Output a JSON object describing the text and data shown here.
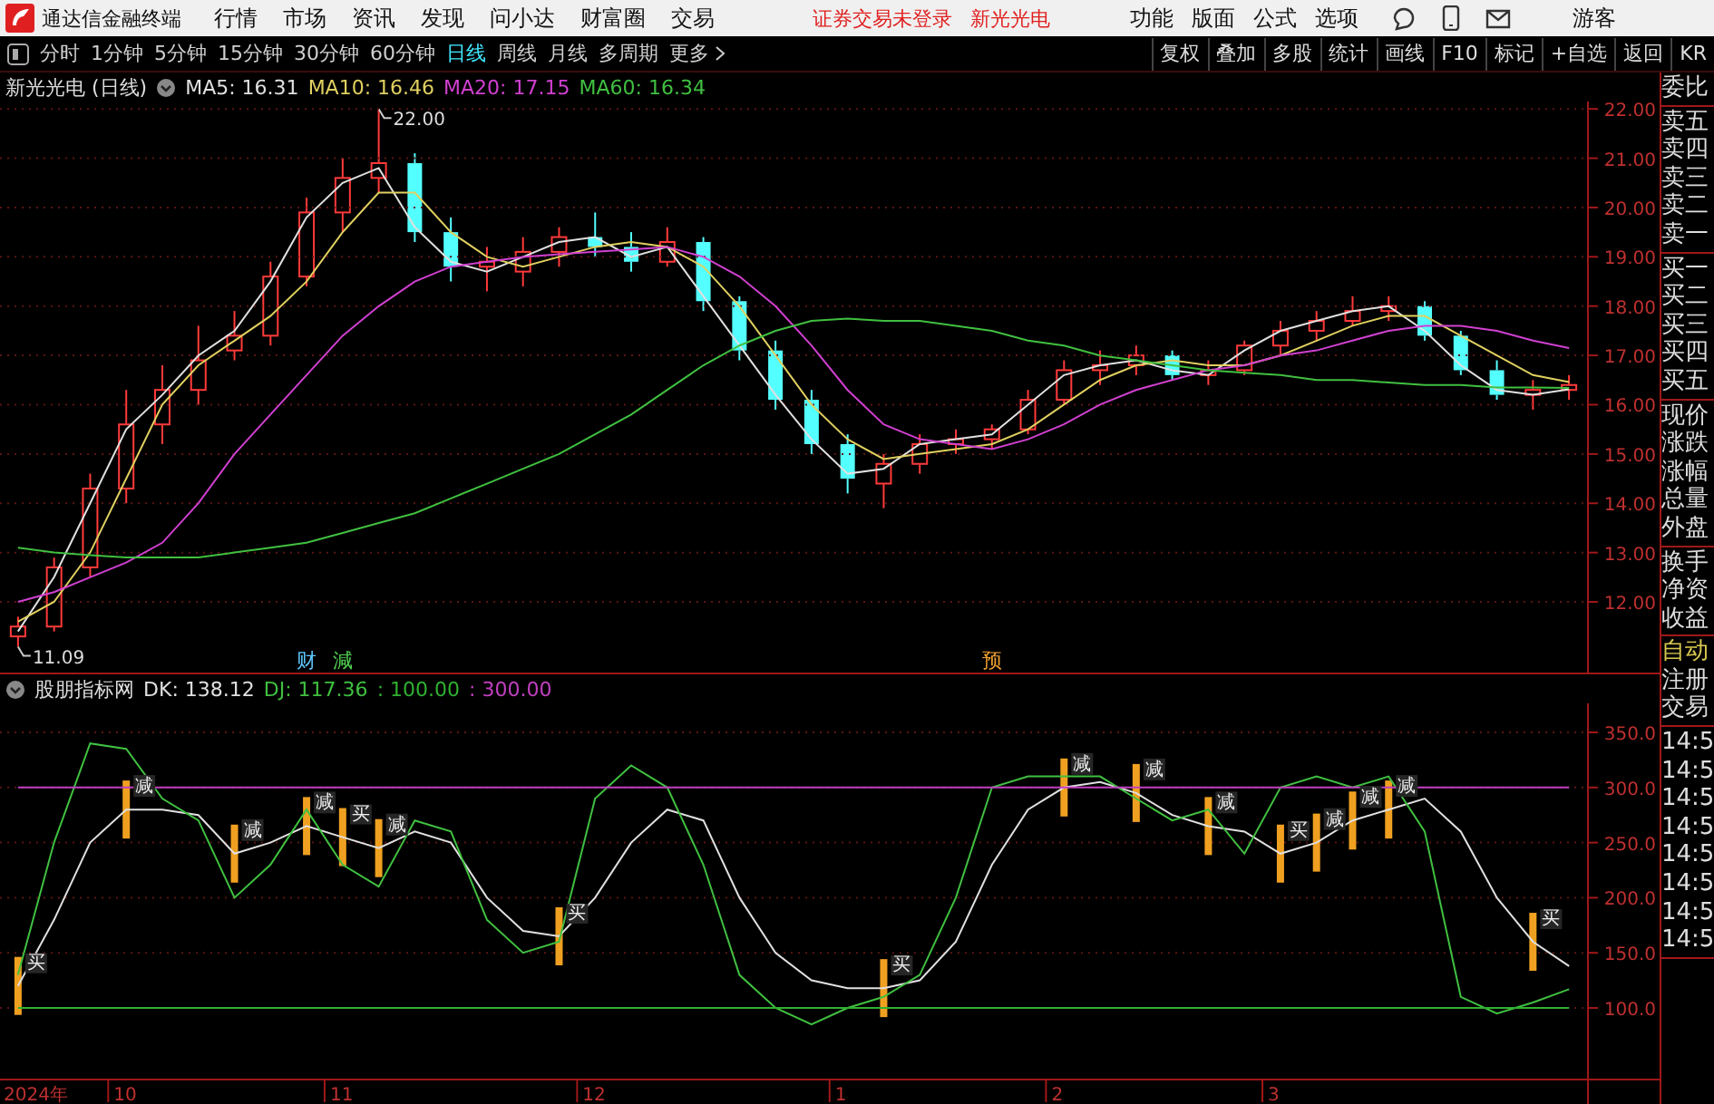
{
  "menu_bar": {
    "app_title": "通达信金融终端",
    "menus": [
      "行情",
      "市场",
      "资讯",
      "发现",
      "问小达",
      "财富圈",
      "交易"
    ],
    "login_status": "证券交易未登录",
    "stock_name": "新光光电",
    "tools": [
      "功能",
      "版面",
      "公式",
      "选项"
    ],
    "user": "游客"
  },
  "toolbar": {
    "periods": [
      {
        "label": "分时",
        "selected": false
      },
      {
        "label": "1分钟",
        "selected": false
      },
      {
        "label": "5分钟",
        "selected": false
      },
      {
        "label": "15分钟",
        "selected": false
      },
      {
        "label": "30分钟",
        "selected": false
      },
      {
        "label": "60分钟",
        "selected": false
      },
      {
        "label": "日线",
        "selected": true
      },
      {
        "label": "周线",
        "selected": false
      },
      {
        "label": "月线",
        "selected": false
      },
      {
        "label": "多周期",
        "selected": false
      }
    ],
    "more": "更多",
    "actions": [
      "复权",
      "叠加",
      "多股",
      "统计",
      "画线",
      "F10",
      "标记",
      "+自选",
      "返回",
      "KR"
    ]
  },
  "price_chart": {
    "title": "新光光电 (日线)",
    "legend": [
      ": 16.31",
      ": 16.46",
      ": 17.15",
      ": 16.34"
    ],
    "event_marks": [
      {
        "text": "财",
        "color": "#5fc8ff"
      },
      {
        "text": "減",
        "color": "#50d050"
      },
      {
        "text": "预",
        "color": "#f0a030"
      }
    ],
    "candles": {
      "chart_data": {
        "type": "candlestick",
        "ohlc": [
          [
            11.3,
            11.7,
            11.09,
            11.5
          ],
          [
            11.5,
            12.9,
            11.4,
            12.7
          ],
          [
            12.7,
            14.6,
            12.5,
            14.3
          ],
          [
            14.3,
            16.3,
            14.0,
            15.6
          ],
          [
            15.6,
            16.8,
            15.2,
            16.3
          ],
          [
            16.3,
            17.6,
            16.0,
            16.9
          ],
          [
            17.1,
            17.9,
            16.9,
            17.4
          ],
          [
            17.4,
            18.9,
            17.2,
            18.6
          ],
          [
            18.6,
            20.2,
            18.4,
            19.9
          ],
          [
            19.9,
            21.0,
            19.5,
            20.6
          ],
          [
            20.6,
            22.0,
            20.3,
            20.9
          ],
          [
            20.9,
            21.1,
            19.3,
            19.5
          ],
          [
            19.5,
            19.8,
            18.5,
            18.8
          ],
          [
            18.8,
            19.2,
            18.3,
            18.9
          ],
          [
            18.7,
            19.4,
            18.4,
            19.1
          ],
          [
            19.1,
            19.6,
            18.8,
            19.4
          ],
          [
            19.4,
            19.9,
            19.0,
            19.2
          ],
          [
            19.2,
            19.5,
            18.7,
            18.9
          ],
          [
            18.9,
            19.6,
            18.8,
            19.3
          ],
          [
            19.3,
            19.4,
            17.9,
            18.1
          ],
          [
            18.1,
            18.2,
            16.9,
            17.1
          ],
          [
            17.1,
            17.3,
            15.9,
            16.1
          ],
          [
            16.1,
            16.3,
            15.0,
            15.2
          ],
          [
            15.2,
            15.4,
            14.2,
            14.5
          ],
          [
            14.4,
            15.0,
            13.9,
            14.8
          ],
          [
            14.8,
            15.4,
            14.6,
            15.2
          ],
          [
            15.2,
            15.5,
            15.0,
            15.3
          ],
          [
            15.3,
            15.6,
            15.1,
            15.5
          ],
          [
            15.5,
            16.3,
            15.4,
            16.1
          ],
          [
            16.1,
            16.9,
            16.0,
            16.7
          ],
          [
            16.7,
            17.1,
            16.4,
            16.8
          ],
          [
            16.8,
            17.2,
            16.6,
            17.0
          ],
          [
            17.0,
            17.1,
            16.5,
            16.6
          ],
          [
            16.6,
            16.9,
            16.4,
            16.7
          ],
          [
            16.7,
            17.3,
            16.6,
            17.2
          ],
          [
            17.2,
            17.7,
            17.0,
            17.5
          ],
          [
            17.5,
            17.9,
            17.3,
            17.7
          ],
          [
            17.7,
            18.2,
            17.6,
            17.9
          ],
          [
            17.9,
            18.2,
            17.7,
            18.0
          ],
          [
            18.0,
            18.1,
            17.3,
            17.4
          ],
          [
            17.4,
            17.5,
            16.6,
            16.7
          ],
          [
            16.7,
            16.9,
            16.1,
            16.2
          ],
          [
            16.2,
            16.5,
            15.9,
            16.3
          ],
          [
            16.3,
            16.6,
            16.1,
            16.4
          ]
        ],
        "ylim": [
          10.53,
          22.15
        ],
        "annotations": [
          "22.00",
          "11.09"
        ]
      }
    },
    "averages": {
      "chart_data": {
        "type": "line",
        "grid": true,
        "ylim": [
          10.53,
          22.15
        ],
        "yticks": [
          {
            "value": 22,
            "label": "22.00"
          },
          {
            "value": 21,
            "label": "21.00"
          },
          {
            "value": 20,
            "label": "20.00"
          },
          {
            "value": 19,
            "label": "19.00"
          },
          {
            "value": 18,
            "label": "18.00"
          },
          {
            "value": 17,
            "label": "17.00"
          },
          {
            "value": 16,
            "label": "16.00"
          },
          {
            "value": 15,
            "label": "15.00"
          },
          {
            "value": 14,
            "label": "14.00"
          },
          {
            "value": 13,
            "label": "13.00"
          },
          {
            "value": 12,
            "label": "12.00"
          }
        ],
        "series": [
          {
            "name": "MA5",
            "color": "#e0e0e0",
            "values": [
              11.4,
              12.5,
              14.0,
              15.5,
              16.2,
              17.0,
              17.5,
              18.5,
              19.8,
              20.5,
              20.8,
              19.6,
              18.9,
              18.7,
              19.0,
              19.3,
              19.4,
              19.0,
              19.2,
              18.2,
              17.2,
              16.2,
              15.3,
              14.6,
              14.7,
              15.2,
              15.3,
              15.4,
              16.0,
              16.6,
              16.8,
              16.9,
              16.7,
              16.6,
              17.1,
              17.5,
              17.7,
              17.9,
              18.0,
              17.5,
              16.8,
              16.3,
              16.2,
              16.31
            ]
          },
          {
            "name": "MA10",
            "color": "#e0d060",
            "values": [
              11.6,
              12.0,
              13.0,
              14.5,
              16.0,
              16.8,
              17.3,
              17.8,
              18.5,
              19.5,
              20.3,
              20.3,
              19.5,
              19.0,
              18.8,
              19.0,
              19.2,
              19.3,
              19.2,
              18.8,
              18.0,
              17.0,
              16.0,
              15.3,
              14.9,
              15.0,
              15.1,
              15.2,
              15.5,
              16.0,
              16.5,
              16.8,
              16.9,
              16.8,
              16.8,
              17.0,
              17.3,
              17.6,
              17.8,
              17.8,
              17.4,
              17.0,
              16.6,
              16.46
            ]
          },
          {
            "name": "MA20",
            "color": "#d040d0",
            "values": [
              12.0,
              12.2,
              12.5,
              12.8,
              13.2,
              14.0,
              15.0,
              15.8,
              16.6,
              17.4,
              18.0,
              18.5,
              18.8,
              18.9,
              19.0,
              19.05,
              19.1,
              19.15,
              19.2,
              19.0,
              18.6,
              18.0,
              17.2,
              16.3,
              15.6,
              15.3,
              15.2,
              15.1,
              15.3,
              15.6,
              16.0,
              16.3,
              16.5,
              16.7,
              16.8,
              17.0,
              17.1,
              17.3,
              17.5,
              17.6,
              17.6,
              17.5,
              17.3,
              17.15
            ]
          },
          {
            "name": "MA60",
            "color": "#40c040",
            "values": [
              13.1,
              13.0,
              12.95,
              12.9,
              12.9,
              12.9,
              13.0,
              13.1,
              13.2,
              13.4,
              13.6,
              13.8,
              14.1,
              14.4,
              14.7,
              15.0,
              15.4,
              15.8,
              16.3,
              16.8,
              17.2,
              17.5,
              17.7,
              17.75,
              17.7,
              17.7,
              17.6,
              17.5,
              17.3,
              17.2,
              17.0,
              16.9,
              16.8,
              16.7,
              16.65,
              16.6,
              16.5,
              16.5,
              16.45,
              16.4,
              16.4,
              16.35,
              16.35,
              16.34
            ]
          }
        ]
      }
    }
  },
  "indicator_chart": {
    "title": "股朋指标网",
    "legend": [
      ": 138.12",
      ": 117.36",
      ": 100.00",
      ": 300.00"
    ],
    "signals": [
      "买",
      "减",
      "减",
      "减",
      "买",
      "减",
      "买",
      "买",
      "减",
      "减",
      "减",
      "买",
      "减",
      "减",
      "减",
      "买"
    ],
    "date_labels": [
      "2024年",
      "10",
      "11",
      "12",
      "1",
      "2",
      "3"
    ],
    "chart_data": {
      "type": "line",
      "grid": true,
      "ylim": [
        35.9,
        376.3
      ],
      "yticks": [
        {
          "value": 350,
          "label": "350.0"
        },
        {
          "value": 300,
          "label": "300.0"
        },
        {
          "value": 250,
          "label": "250.0"
        },
        {
          "value": 200,
          "label": "200.0"
        },
        {
          "value": 150,
          "label": "150.0"
        },
        {
          "value": 100,
          "label": "100.0"
        }
      ],
      "series": [
        {
          "name": "DK",
          "color": "#e0e0e0",
          "values": [
            120,
            180,
            250,
            280,
            280,
            275,
            240,
            250,
            265,
            255,
            245,
            260,
            250,
            200,
            170,
            165,
            200,
            250,
            280,
            270,
            200,
            150,
            125,
            118,
            118,
            125,
            160,
            230,
            280,
            300,
            305,
            295,
            275,
            265,
            260,
            240,
            250,
            270,
            280,
            290,
            260,
            200,
            160,
            138
          ]
        },
        {
          "name": "DJ",
          "color": "#40c040",
          "values": [
            130,
            250,
            340,
            335,
            290,
            270,
            200,
            230,
            280,
            230,
            210,
            270,
            260,
            180,
            150,
            160,
            290,
            320,
            300,
            230,
            130,
            100,
            85,
            100,
            110,
            130,
            200,
            300,
            310,
            310,
            310,
            290,
            270,
            280,
            240,
            300,
            310,
            300,
            310,
            260,
            110,
            95,
            105,
            117
          ]
        },
        {
          "color": "#30b030",
          "values": [
            100,
            100,
            100,
            100,
            100,
            100,
            100,
            100,
            100,
            100,
            100,
            100,
            100,
            100,
            100,
            100,
            100,
            100,
            100,
            100,
            100,
            100,
            100,
            100,
            100,
            100,
            100,
            100,
            100,
            100,
            100,
            100,
            100,
            100,
            100,
            100,
            100,
            100,
            100,
            100,
            100,
            100,
            100,
            100
          ]
        },
        {
          "color": "#c040c0",
          "values": [
            300,
            300,
            300,
            300,
            300,
            300,
            300,
            300,
            300,
            300,
            300,
            300,
            300,
            300,
            300,
            300,
            300,
            300,
            300,
            300,
            300,
            300,
            300,
            300,
            300,
            300,
            300,
            300,
            300,
            300,
            300,
            300,
            300,
            300,
            300,
            300,
            300,
            300,
            300,
            300,
            300,
            300,
            300,
            300
          ]
        }
      ]
    }
  },
  "quote_panel": {
    "groups": [
      [
        {
          "text": "委比",
          "active": false
        }
      ],
      [
        {
          "text": "卖五",
          "active": false
        },
        {
          "text": "卖四",
          "active": false
        },
        {
          "text": "卖三",
          "active": false
        },
        {
          "text": "卖二",
          "active": false
        },
        {
          "text": "卖一",
          "active": false
        }
      ],
      [
        {
          "text": "买一",
          "active": false
        },
        {
          "text": "买二",
          "active": false
        },
        {
          "text": "买三",
          "active": false
        },
        {
          "text": "买四",
          "active": false
        },
        {
          "text": "买五",
          "active": false
        }
      ],
      [
        {
          "text": "现价",
          "active": false
        },
        {
          "text": "涨跌",
          "active": false
        },
        {
          "text": "涨幅",
          "active": false
        },
        {
          "text": "总量",
          "active": false
        },
        {
          "text": "外盘",
          "active": false
        }
      ],
      [
        {
          "text": "换手",
          "active": false
        },
        {
          "text": "净资",
          "active": false
        },
        {
          "text": "收益",
          "active": false
        }
      ],
      [
        {
          "text": "自动",
          "active": true
        },
        {
          "text": "注册",
          "active": false
        },
        {
          "text": "交易",
          "active": false
        }
      ],
      [
        {
          "text": "14:5",
          "active": false
        },
        {
          "text": "14:5",
          "active": false
        },
        {
          "text": "14:5",
          "active": false
        },
        {
          "text": "14:5",
          "active": false
        },
        {
          "text": "14:5",
          "active": false
        },
        {
          "text": "14:5",
          "active": false
        },
        {
          "text": "14:5",
          "active": false
        },
        {
          "text": "14:5",
          "active": false
        }
      ]
    ]
  }
}
